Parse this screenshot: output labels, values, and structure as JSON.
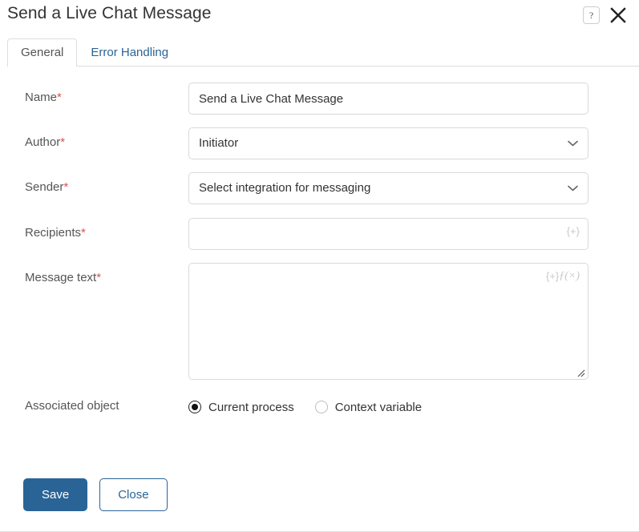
{
  "dialog": {
    "title": "Send a Live Chat Message",
    "help_icon": "question-mark-icon",
    "close_icon": "close-icon"
  },
  "tabs": [
    {
      "label": "General",
      "active": true
    },
    {
      "label": "Error Handling",
      "active": false
    }
  ],
  "form": {
    "name": {
      "label": "Name",
      "required": "*",
      "value": "Send a Live Chat Message"
    },
    "author": {
      "label": "Author",
      "required": "*",
      "value": "Initiator",
      "chevron_icon": "chevron-down-icon"
    },
    "sender": {
      "label": "Sender",
      "required": "*",
      "value": "Select integration for messaging",
      "chevron_icon": "chevron-down-icon"
    },
    "recipients": {
      "label": "Recipients",
      "required": "*",
      "value": "",
      "placeholder": "",
      "token_icon": "{+}"
    },
    "message_text": {
      "label": "Message text",
      "required": "*",
      "value": "",
      "placeholder": "",
      "token_icon": "{+}",
      "formula_icon": "ƒ(×)"
    },
    "associated_object": {
      "label": "Associated object",
      "required": "",
      "options": [
        {
          "label": "Current process",
          "checked": true
        },
        {
          "label": "Context variable",
          "checked": false
        }
      ]
    }
  },
  "footer": {
    "save_label": "Save",
    "close_label": "Close"
  },
  "colors": {
    "primary": "#2a6496",
    "link": "#2a6496",
    "required": "#d9534f",
    "border": "#d9d9d9",
    "text": "#333333"
  }
}
